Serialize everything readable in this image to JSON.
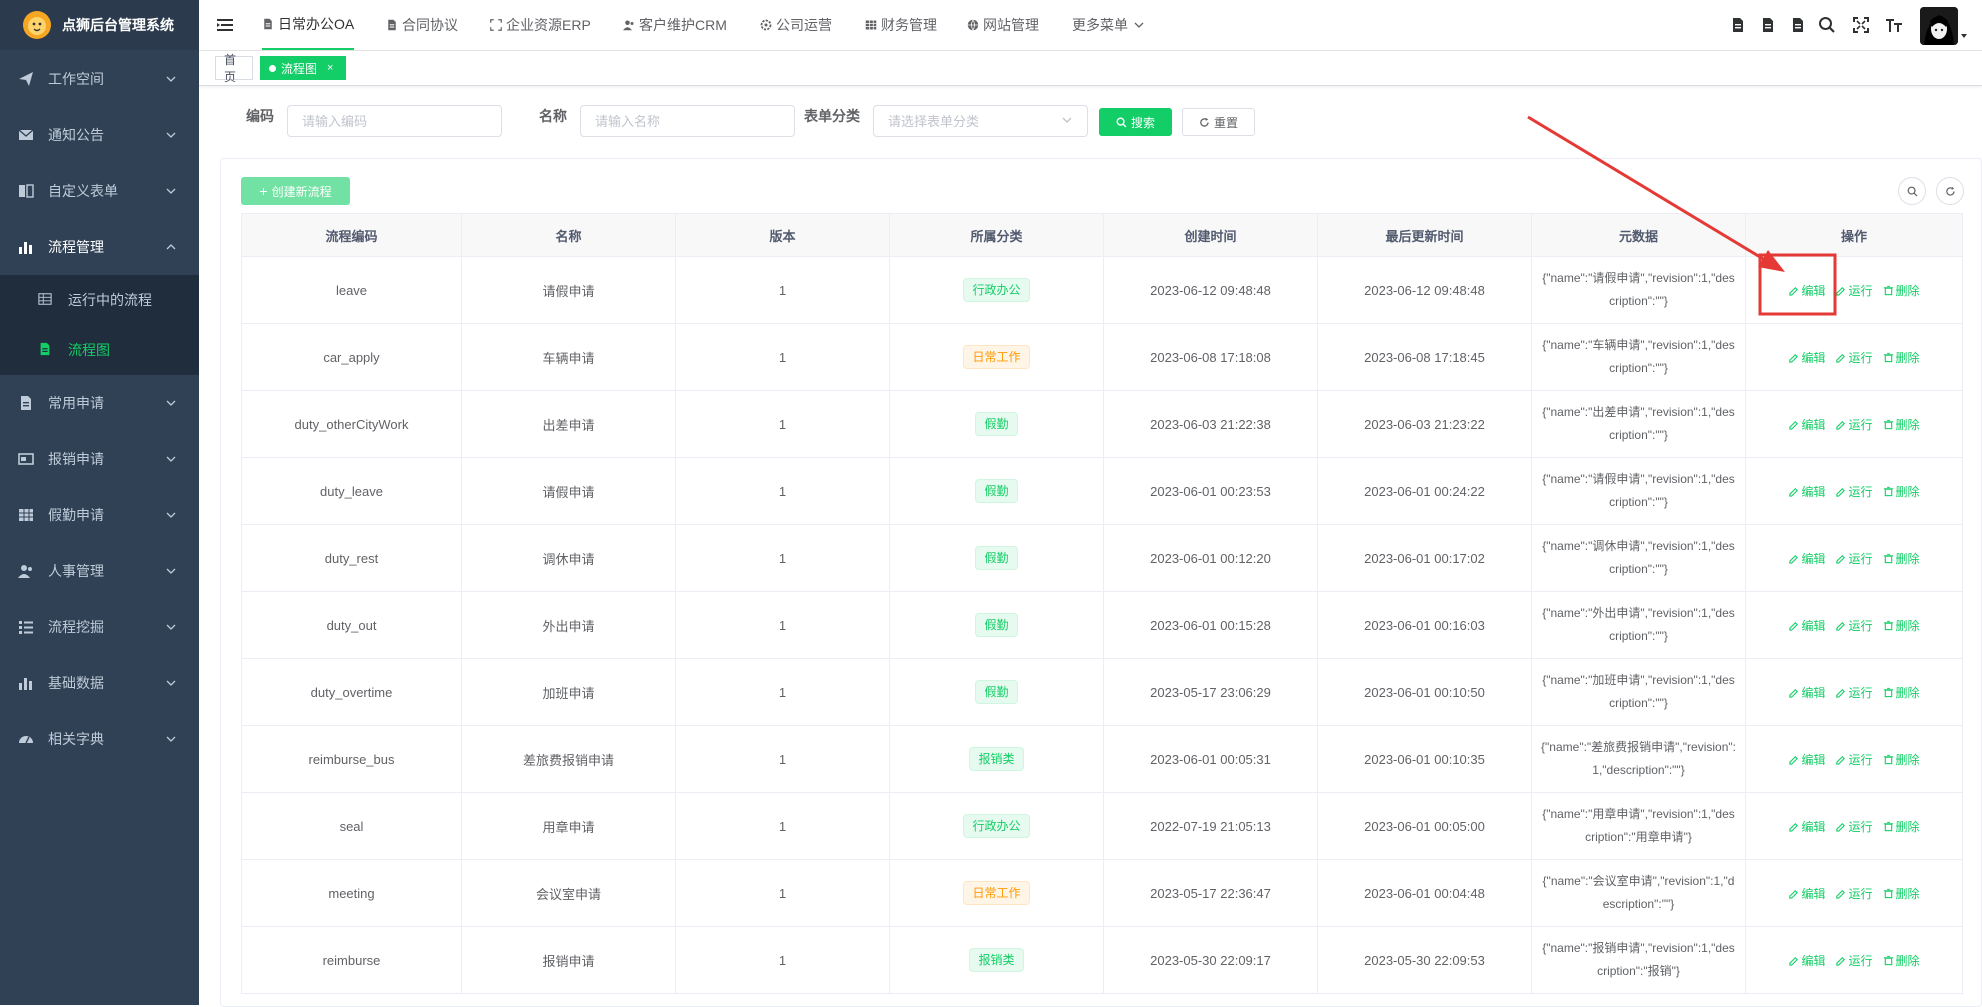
{
  "app": {
    "title": "点狮后台管理系统"
  },
  "sidebar": {
    "items": [
      {
        "label": "工作空间",
        "icon": "paper-plane-icon"
      },
      {
        "label": "通知公告",
        "icon": "envelope-icon"
      },
      {
        "label": "自定义表单",
        "icon": "book-icon"
      },
      {
        "label": "流程管理",
        "icon": "bar-chart-icon",
        "expanded": true
      },
      {
        "label": "常用申请",
        "icon": "document-icon"
      },
      {
        "label": "报销申请",
        "icon": "card-icon"
      },
      {
        "label": "假勤申请",
        "icon": "table-icon"
      },
      {
        "label": "人事管理",
        "icon": "user-icon"
      },
      {
        "label": "流程挖掘",
        "icon": "list-icon"
      },
      {
        "label": "基础数据",
        "icon": "bar-chart-icon"
      },
      {
        "label": "相关字典",
        "icon": "dashboard-icon"
      }
    ],
    "subitems": [
      {
        "label": "运行中的流程",
        "icon": "grid-icon"
      },
      {
        "label": "流程图",
        "icon": "file-icon",
        "active": true
      }
    ]
  },
  "topnav": {
    "tabs": [
      {
        "label": "日常办公OA",
        "active": true
      },
      {
        "label": "合同协议"
      },
      {
        "label": "企业资源ERP"
      },
      {
        "label": "客户维护CRM"
      },
      {
        "label": "公司运营"
      },
      {
        "label": "财务管理"
      },
      {
        "label": "网站管理"
      },
      {
        "label": "更多菜单"
      }
    ]
  },
  "tagsview": {
    "home": "首页",
    "current": "流程图",
    "close": "×"
  },
  "search": {
    "code_label": "编码",
    "code_placeholder": "请输入编码",
    "name_label": "名称",
    "name_placeholder": "请输入名称",
    "category_label": "表单分类",
    "category_placeholder": "请选择表单分类",
    "search_button": "搜索",
    "reset_button": "重置"
  },
  "toolbar": {
    "create_button": "创建新流程"
  },
  "table": {
    "headers": [
      "流程编码",
      "名称",
      "版本",
      "所属分类",
      "创建时间",
      "最后更新时间",
      "元数据",
      "操作"
    ],
    "actions": {
      "edit": "编辑",
      "run": "运行",
      "delete": "删除"
    },
    "category_colors": {
      "行政办公": "green",
      "日常工作": "orange",
      "假勤": "green",
      "报销类": "green"
    },
    "rows": [
      {
        "code": "leave",
        "name": "请假申请",
        "version": "1",
        "category": "行政办公",
        "created": "2023-06-12 09:48:48",
        "updated": "2023-06-12 09:48:48",
        "meta": "{\"name\":\"请假申请\",\"revision\":1,\"description\":\"\"}"
      },
      {
        "code": "car_apply",
        "name": "车辆申请",
        "version": "1",
        "category": "日常工作",
        "created": "2023-06-08 17:18:08",
        "updated": "2023-06-08 17:18:45",
        "meta": "{\"name\":\"车辆申请\",\"revision\":1,\"description\":\"\"}"
      },
      {
        "code": "duty_otherCityWork",
        "name": "出差申请",
        "version": "1",
        "category": "假勤",
        "created": "2023-06-03 21:22:38",
        "updated": "2023-06-03 21:23:22",
        "meta": "{\"name\":\"出差申请\",\"revision\":1,\"description\":\"\"}"
      },
      {
        "code": "duty_leave",
        "name": "请假申请",
        "version": "1",
        "category": "假勤",
        "created": "2023-06-01 00:23:53",
        "updated": "2023-06-01 00:24:22",
        "meta": "{\"name\":\"请假申请\",\"revision\":1,\"description\":\"\"}"
      },
      {
        "code": "duty_rest",
        "name": "调休申请",
        "version": "1",
        "category": "假勤",
        "created": "2023-06-01 00:12:20",
        "updated": "2023-06-01 00:17:02",
        "meta": "{\"name\":\"调休申请\",\"revision\":1,\"description\":\"\"}"
      },
      {
        "code": "duty_out",
        "name": "外出申请",
        "version": "1",
        "category": "假勤",
        "created": "2023-06-01 00:15:28",
        "updated": "2023-06-01 00:16:03",
        "meta": "{\"name\":\"外出申请\",\"revision\":1,\"description\":\"\"}"
      },
      {
        "code": "duty_overtime",
        "name": "加班申请",
        "version": "1",
        "category": "假勤",
        "created": "2023-05-17 23:06:29",
        "updated": "2023-06-01 00:10:50",
        "meta": "{\"name\":\"加班申请\",\"revision\":1,\"description\":\"\"}"
      },
      {
        "code": "reimburse_bus",
        "name": "差旅费报销申请",
        "version": "1",
        "category": "报销类",
        "created": "2023-06-01 00:05:31",
        "updated": "2023-06-01 00:10:35",
        "meta": "{\"name\":\"差旅费报销申请\",\"revision\":1,\"description\":\"\"}"
      },
      {
        "code": "seal",
        "name": "用章申请",
        "version": "1",
        "category": "行政办公",
        "created": "2022-07-19 21:05:13",
        "updated": "2023-06-01 00:05:00",
        "meta": "{\"name\":\"用章申请\",\"revision\":1,\"description\":\"用章申请\"}"
      },
      {
        "code": "meeting",
        "name": "会议室申请",
        "version": "1",
        "category": "日常工作",
        "created": "2023-05-17 22:36:47",
        "updated": "2023-06-01 00:04:48",
        "meta": "{\"name\":\"会议室申请\",\"revision\":1,\"description\":\"\"}"
      },
      {
        "code": "reimburse",
        "name": "报销申请",
        "version": "1",
        "category": "报销类",
        "created": "2023-05-30 22:09:17",
        "updated": "2023-05-30 22:09:53",
        "meta": "{\"name\":\"报销申请\",\"revision\":1,\"description\":\"报销\"}"
      }
    ]
  },
  "colors": {
    "accent": "#13ce66",
    "sidebar": "#304156",
    "annotation": "#e53935"
  }
}
